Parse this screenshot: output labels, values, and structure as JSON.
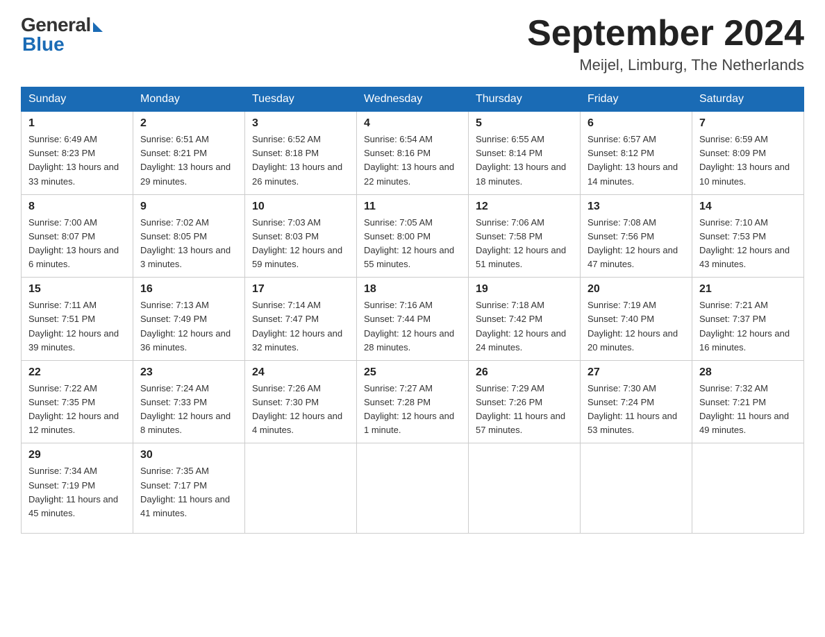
{
  "logo": {
    "general": "General",
    "blue": "Blue"
  },
  "title": "September 2024",
  "location": "Meijel, Limburg, The Netherlands",
  "days_of_week": [
    "Sunday",
    "Monday",
    "Tuesday",
    "Wednesday",
    "Thursday",
    "Friday",
    "Saturday"
  ],
  "weeks": [
    [
      {
        "day": "1",
        "sunrise": "6:49 AM",
        "sunset": "8:23 PM",
        "daylight": "13 hours and 33 minutes."
      },
      {
        "day": "2",
        "sunrise": "6:51 AM",
        "sunset": "8:21 PM",
        "daylight": "13 hours and 29 minutes."
      },
      {
        "day": "3",
        "sunrise": "6:52 AM",
        "sunset": "8:18 PM",
        "daylight": "13 hours and 26 minutes."
      },
      {
        "day": "4",
        "sunrise": "6:54 AM",
        "sunset": "8:16 PM",
        "daylight": "13 hours and 22 minutes."
      },
      {
        "day": "5",
        "sunrise": "6:55 AM",
        "sunset": "8:14 PM",
        "daylight": "13 hours and 18 minutes."
      },
      {
        "day": "6",
        "sunrise": "6:57 AM",
        "sunset": "8:12 PM",
        "daylight": "13 hours and 14 minutes."
      },
      {
        "day": "7",
        "sunrise": "6:59 AM",
        "sunset": "8:09 PM",
        "daylight": "13 hours and 10 minutes."
      }
    ],
    [
      {
        "day": "8",
        "sunrise": "7:00 AM",
        "sunset": "8:07 PM",
        "daylight": "13 hours and 6 minutes."
      },
      {
        "day": "9",
        "sunrise": "7:02 AM",
        "sunset": "8:05 PM",
        "daylight": "13 hours and 3 minutes."
      },
      {
        "day": "10",
        "sunrise": "7:03 AM",
        "sunset": "8:03 PM",
        "daylight": "12 hours and 59 minutes."
      },
      {
        "day": "11",
        "sunrise": "7:05 AM",
        "sunset": "8:00 PM",
        "daylight": "12 hours and 55 minutes."
      },
      {
        "day": "12",
        "sunrise": "7:06 AM",
        "sunset": "7:58 PM",
        "daylight": "12 hours and 51 minutes."
      },
      {
        "day": "13",
        "sunrise": "7:08 AM",
        "sunset": "7:56 PM",
        "daylight": "12 hours and 47 minutes."
      },
      {
        "day": "14",
        "sunrise": "7:10 AM",
        "sunset": "7:53 PM",
        "daylight": "12 hours and 43 minutes."
      }
    ],
    [
      {
        "day": "15",
        "sunrise": "7:11 AM",
        "sunset": "7:51 PM",
        "daylight": "12 hours and 39 minutes."
      },
      {
        "day": "16",
        "sunrise": "7:13 AM",
        "sunset": "7:49 PM",
        "daylight": "12 hours and 36 minutes."
      },
      {
        "day": "17",
        "sunrise": "7:14 AM",
        "sunset": "7:47 PM",
        "daylight": "12 hours and 32 minutes."
      },
      {
        "day": "18",
        "sunrise": "7:16 AM",
        "sunset": "7:44 PM",
        "daylight": "12 hours and 28 minutes."
      },
      {
        "day": "19",
        "sunrise": "7:18 AM",
        "sunset": "7:42 PM",
        "daylight": "12 hours and 24 minutes."
      },
      {
        "day": "20",
        "sunrise": "7:19 AM",
        "sunset": "7:40 PM",
        "daylight": "12 hours and 20 minutes."
      },
      {
        "day": "21",
        "sunrise": "7:21 AM",
        "sunset": "7:37 PM",
        "daylight": "12 hours and 16 minutes."
      }
    ],
    [
      {
        "day": "22",
        "sunrise": "7:22 AM",
        "sunset": "7:35 PM",
        "daylight": "12 hours and 12 minutes."
      },
      {
        "day": "23",
        "sunrise": "7:24 AM",
        "sunset": "7:33 PM",
        "daylight": "12 hours and 8 minutes."
      },
      {
        "day": "24",
        "sunrise": "7:26 AM",
        "sunset": "7:30 PM",
        "daylight": "12 hours and 4 minutes."
      },
      {
        "day": "25",
        "sunrise": "7:27 AM",
        "sunset": "7:28 PM",
        "daylight": "12 hours and 1 minute."
      },
      {
        "day": "26",
        "sunrise": "7:29 AM",
        "sunset": "7:26 PM",
        "daylight": "11 hours and 57 minutes."
      },
      {
        "day": "27",
        "sunrise": "7:30 AM",
        "sunset": "7:24 PM",
        "daylight": "11 hours and 53 minutes."
      },
      {
        "day": "28",
        "sunrise": "7:32 AM",
        "sunset": "7:21 PM",
        "daylight": "11 hours and 49 minutes."
      }
    ],
    [
      {
        "day": "29",
        "sunrise": "7:34 AM",
        "sunset": "7:19 PM",
        "daylight": "11 hours and 45 minutes."
      },
      {
        "day": "30",
        "sunrise": "7:35 AM",
        "sunset": "7:17 PM",
        "daylight": "11 hours and 41 minutes."
      },
      null,
      null,
      null,
      null,
      null
    ]
  ],
  "labels": {
    "sunrise": "Sunrise:",
    "sunset": "Sunset:",
    "daylight": "Daylight:"
  }
}
